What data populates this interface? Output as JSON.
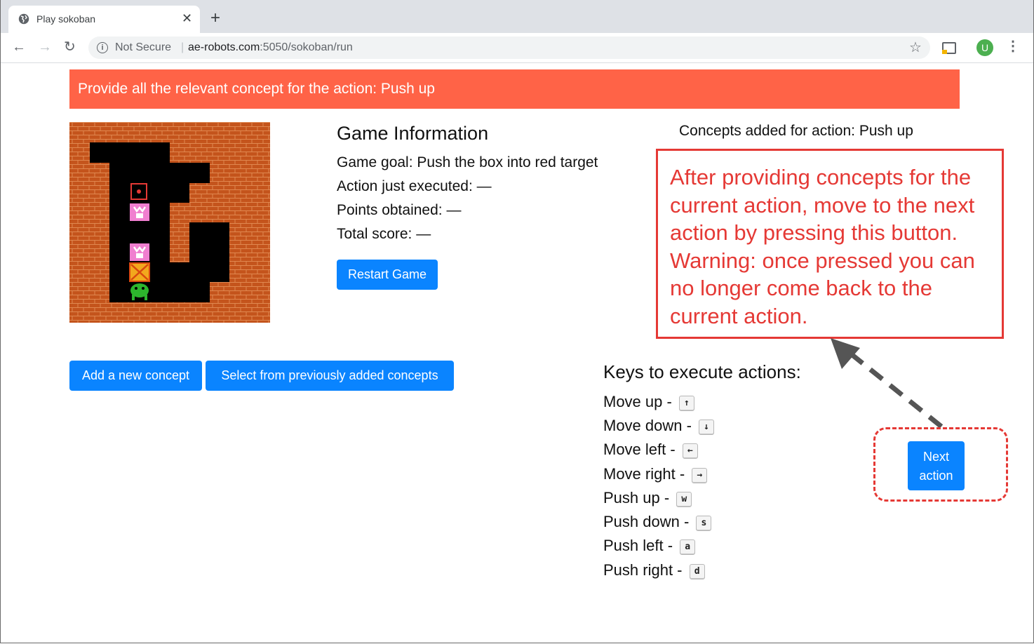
{
  "browser": {
    "tab_title": "Play sokoban",
    "tab_close": "✕",
    "new_tab": "+",
    "back": "←",
    "forward": "→",
    "reload": "↻",
    "security_label": "Not Secure",
    "url_host": "ae-robots.com",
    "url_path": ":5050/sokoban/run",
    "bookmark": "☆",
    "avatar_letter": "U",
    "menu": "⋮"
  },
  "banner": {
    "text": "Provide all the relevant concept for the action: Push up",
    "color": "#ff6347"
  },
  "game_info": {
    "title": "Game Information",
    "goal": "Game goal: Push the box into red target",
    "action": "Action just executed: —",
    "points": "Points obtained: —",
    "score": "Total score: —",
    "restart_label": "Restart Game"
  },
  "concepts": {
    "heading": "Concepts added for action: Push up",
    "add_label": "Add a new concept",
    "select_label": "Select from previously added concepts"
  },
  "annotation": {
    "text": "After providing concepts for the current action, move to the next action by pressing this button. Warning: once pressed you can no longer come back to the current action.",
    "color": "#e53935"
  },
  "keys": {
    "title": "Keys to execute actions:",
    "items": [
      {
        "label": "Move up -",
        "key": "↑"
      },
      {
        "label": "Move down -",
        "key": "↓"
      },
      {
        "label": "Move left -",
        "key": "←"
      },
      {
        "label": "Move right -",
        "key": "→"
      },
      {
        "label": "Push up -",
        "key": "w"
      },
      {
        "label": "Push down -",
        "key": "s"
      },
      {
        "label": "Push left -",
        "key": "a"
      },
      {
        "label": "Push right -",
        "key": "d"
      }
    ]
  },
  "next_action": {
    "line1": "Next",
    "line2": "action"
  },
  "colors": {
    "button_blue": "#0a84ff",
    "brick": "#c4541c",
    "floor": "#000000",
    "target": "#e53935",
    "box": "#f2a81d",
    "player": "#2db52d",
    "ghost": "#f07fd0"
  }
}
